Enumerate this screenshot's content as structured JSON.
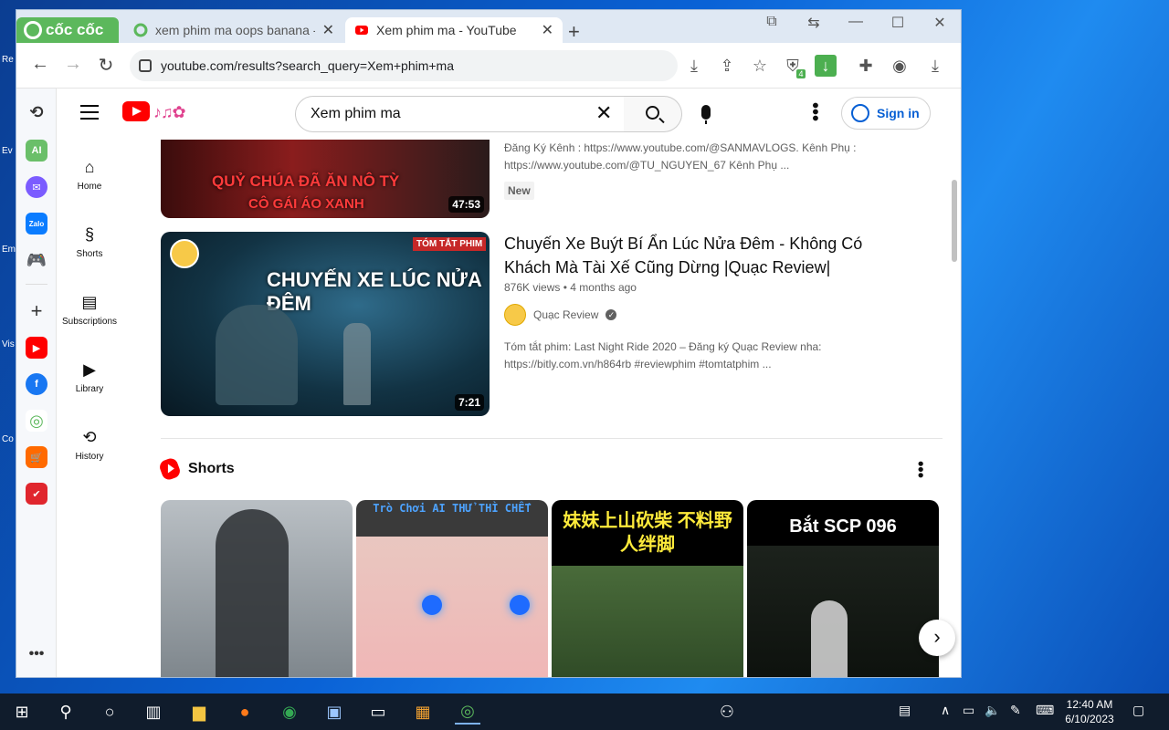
{
  "browser": {
    "brand": "cốc cốc",
    "tabs": [
      {
        "title": "xem phim ma oops banana -",
        "active": false
      },
      {
        "title": "Xem phim ma - YouTube",
        "active": true
      }
    ],
    "url": "youtube.com/results?search_query=Xem+phim+ma",
    "extension_badge": "4"
  },
  "sidebar_cc": {
    "ai_label": "AI",
    "zalo_label": "Zalo"
  },
  "youtube": {
    "search_value": "Xem phim ma",
    "signin_label": "Sign in",
    "guide": [
      {
        "label": "Home",
        "icon": "home-icon"
      },
      {
        "label": "Shorts",
        "icon": "shorts-icon"
      },
      {
        "label": "Subscriptions",
        "icon": "subscriptions-icon"
      },
      {
        "label": "Library",
        "icon": "library-icon"
      },
      {
        "label": "History",
        "icon": "history-icon"
      }
    ],
    "video1": {
      "thumb_caption_line1": "QUỶ CHÚA ĐÃ ĂN NÔ TỲ",
      "thumb_caption_line2": "CÔ GÁI ÁO XANH",
      "duration": "47:53",
      "desc_line1": "Đăng Ký Kênh : https://www.youtube.com/@SANMAVLOGS. Kênh Phụ :",
      "desc_line2": "https://www.youtube.com/@TU_NGUYEN_67 Kênh Phụ ...",
      "badge": "New"
    },
    "video2": {
      "title_line1": "Chuyến Xe Buýt Bí Ẩn Lúc Nửa Đêm - Không Có",
      "title_line2": "Khách Mà Tài Xế Cũng Dừng |Quạc Review|",
      "views": "876K views",
      "age": "4 months ago",
      "channel": "Quạc Review",
      "thumb_caption": "CHUYẾN XE LÚC NỬA ĐÊM",
      "thumb_tag": "TÓM TẮT PHIM",
      "duration": "7:21",
      "desc_line1": "Tóm tắt phim: Last Night Ride 2020 – Đăng ký Quạc Review nha:",
      "desc_line2": "https://bitly.com.vn/h864rb #reviewphim #tomtatphim ..."
    },
    "shorts_title": "Shorts",
    "shorts": [
      {
        "caption": ""
      },
      {
        "caption": "Trò Chơi AI THỬ THÌ CHẾT"
      },
      {
        "caption": "妹妹上山砍柴 不料野人绊脚"
      },
      {
        "caption": "Bắt SCP 096"
      }
    ]
  },
  "taskbar": {
    "time": "12:40 AM",
    "date": "6/10/2023"
  }
}
